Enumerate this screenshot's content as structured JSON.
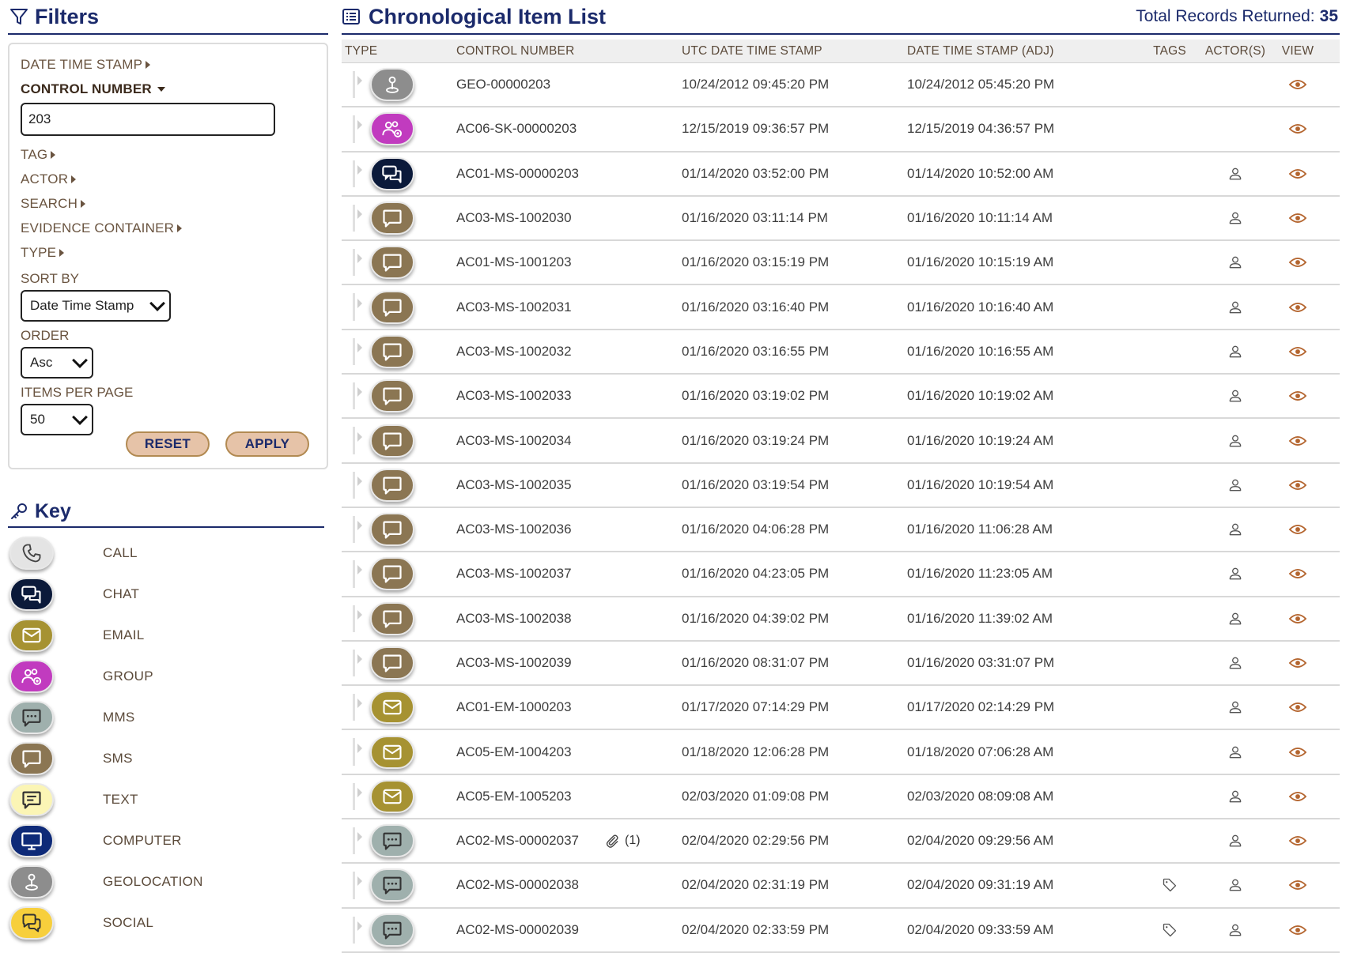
{
  "colors": {
    "navy": "#1b2a6b",
    "call": "#e4e4e4",
    "chat": "#0b1a3a",
    "email": "#a69232",
    "group": "#c13bbf",
    "mms": "#9fb0ad",
    "sms": "#8b7653",
    "text": "#fbf5b5",
    "computer": "#0e2a78",
    "geolocation": "#8d8d8d",
    "social": "#f7cf3c",
    "view_eye": "#b4652f"
  },
  "filters": {
    "title": "Filters",
    "date_time_stamp": "DATE TIME STAMP",
    "control_number": "CONTROL NUMBER",
    "control_number_value": "203",
    "tag": "TAG",
    "actor": "ACTOR",
    "search": "SEARCH",
    "evidence_container": "EVIDENCE CONTAINER",
    "type": "TYPE",
    "sort_by_label": "SORT BY",
    "sort_by_value": "Date Time Stamp",
    "order_label": "ORDER",
    "order_value": "Asc",
    "items_per_page_label": "ITEMS PER PAGE",
    "items_per_page_value": "50",
    "reset": "RESET",
    "apply": "APPLY"
  },
  "key": {
    "title": "Key",
    "items": [
      {
        "label": "CALL",
        "icon": "phone-icon"
      },
      {
        "label": "CHAT",
        "icon": "chat-icon"
      },
      {
        "label": "EMAIL",
        "icon": "email-icon"
      },
      {
        "label": "GROUP",
        "icon": "group-icon"
      },
      {
        "label": "MMS",
        "icon": "mms-icon"
      },
      {
        "label": "SMS",
        "icon": "sms-icon"
      },
      {
        "label": "TEXT",
        "icon": "text-icon"
      },
      {
        "label": "COMPUTER",
        "icon": "computer-icon"
      },
      {
        "label": "GEOLOCATION",
        "icon": "geolocation-icon"
      },
      {
        "label": "SOCIAL",
        "icon": "social-icon"
      }
    ]
  },
  "list": {
    "title": "Chronological Item List",
    "total_label": "Total Records Returned:",
    "total_value": "35",
    "columns": {
      "type": "TYPE",
      "control": "CONTROL NUMBER",
      "utc": "UTC DATE TIME STAMP",
      "adj": "DATE TIME STAMP (ADJ)",
      "tags": "TAGS",
      "actors": "ACTOR(S)",
      "view": "VIEW"
    },
    "rows": [
      {
        "type": "geolocation",
        "control": "GEO-00000203",
        "utc": "10/24/2012 09:45:20 PM",
        "adj": "10/24/2012 05:45:20 PM",
        "attachment": "",
        "tag": false,
        "actor": false
      },
      {
        "type": "group",
        "control": "AC06-SK-00000203",
        "utc": "12/15/2019 09:36:57 PM",
        "adj": "12/15/2019 04:36:57 PM",
        "attachment": "",
        "tag": false,
        "actor": false
      },
      {
        "type": "chat",
        "control": "AC01-MS-00000203",
        "utc": "01/14/2020 03:52:00 PM",
        "adj": "01/14/2020 10:52:00 AM",
        "attachment": "",
        "tag": false,
        "actor": true
      },
      {
        "type": "sms",
        "control": "AC03-MS-1002030",
        "utc": "01/16/2020 03:11:14 PM",
        "adj": "01/16/2020 10:11:14 AM",
        "attachment": "",
        "tag": false,
        "actor": true
      },
      {
        "type": "sms",
        "control": "AC01-MS-1001203",
        "utc": "01/16/2020 03:15:19 PM",
        "adj": "01/16/2020 10:15:19 AM",
        "attachment": "",
        "tag": false,
        "actor": true
      },
      {
        "type": "sms",
        "control": "AC03-MS-1002031",
        "utc": "01/16/2020 03:16:40 PM",
        "adj": "01/16/2020 10:16:40 AM",
        "attachment": "",
        "tag": false,
        "actor": true
      },
      {
        "type": "sms",
        "control": "AC03-MS-1002032",
        "utc": "01/16/2020 03:16:55 PM",
        "adj": "01/16/2020 10:16:55 AM",
        "attachment": "",
        "tag": false,
        "actor": true
      },
      {
        "type": "sms",
        "control": "AC03-MS-1002033",
        "utc": "01/16/2020 03:19:02 PM",
        "adj": "01/16/2020 10:19:02 AM",
        "attachment": "",
        "tag": false,
        "actor": true
      },
      {
        "type": "sms",
        "control": "AC03-MS-1002034",
        "utc": "01/16/2020 03:19:24 PM",
        "adj": "01/16/2020 10:19:24 AM",
        "attachment": "",
        "tag": false,
        "actor": true
      },
      {
        "type": "sms",
        "control": "AC03-MS-1002035",
        "utc": "01/16/2020 03:19:54 PM",
        "adj": "01/16/2020 10:19:54 AM",
        "attachment": "",
        "tag": false,
        "actor": true
      },
      {
        "type": "sms",
        "control": "AC03-MS-1002036",
        "utc": "01/16/2020 04:06:28 PM",
        "adj": "01/16/2020 11:06:28 AM",
        "attachment": "",
        "tag": false,
        "actor": true
      },
      {
        "type": "sms",
        "control": "AC03-MS-1002037",
        "utc": "01/16/2020 04:23:05 PM",
        "adj": "01/16/2020 11:23:05 AM",
        "attachment": "",
        "tag": false,
        "actor": true
      },
      {
        "type": "sms",
        "control": "AC03-MS-1002038",
        "utc": "01/16/2020 04:39:02 PM",
        "adj": "01/16/2020 11:39:02 AM",
        "attachment": "",
        "tag": false,
        "actor": true
      },
      {
        "type": "sms",
        "control": "AC03-MS-1002039",
        "utc": "01/16/2020 08:31:07 PM",
        "adj": "01/16/2020 03:31:07 PM",
        "attachment": "",
        "tag": false,
        "actor": true
      },
      {
        "type": "email",
        "control": "AC01-EM-1000203",
        "utc": "01/17/2020 07:14:29 PM",
        "adj": "01/17/2020 02:14:29 PM",
        "attachment": "",
        "tag": false,
        "actor": true
      },
      {
        "type": "email",
        "control": "AC05-EM-1004203",
        "utc": "01/18/2020 12:06:28 PM",
        "adj": "01/18/2020 07:06:28 AM",
        "attachment": "",
        "tag": false,
        "actor": true
      },
      {
        "type": "email",
        "control": "AC05-EM-1005203",
        "utc": "02/03/2020 01:09:08 PM",
        "adj": "02/03/2020 08:09:08 AM",
        "attachment": "",
        "tag": false,
        "actor": true
      },
      {
        "type": "mms",
        "control": "AC02-MS-00002037",
        "utc": "02/04/2020 02:29:56 PM",
        "adj": "02/04/2020 09:29:56 AM",
        "attachment": "(1)",
        "tag": false,
        "actor": true
      },
      {
        "type": "mms",
        "control": "AC02-MS-00002038",
        "utc": "02/04/2020 02:31:19 PM",
        "adj": "02/04/2020 09:31:19 AM",
        "attachment": "",
        "tag": true,
        "actor": true
      },
      {
        "type": "mms",
        "control": "AC02-MS-00002039",
        "utc": "02/04/2020 02:33:59 PM",
        "adj": "02/04/2020 09:33:59 AM",
        "attachment": "",
        "tag": true,
        "actor": true
      }
    ]
  }
}
